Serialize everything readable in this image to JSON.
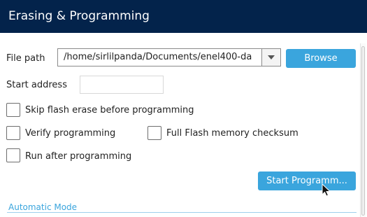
{
  "header": {
    "title": "Erasing & Programming"
  },
  "file_path": {
    "label": "File path",
    "value": "/home/sirlilpanda/Documents/enel400-da",
    "browse_label": "Browse"
  },
  "start_address": {
    "label": "Start address",
    "value": ""
  },
  "options": {
    "skip_flash_erase": {
      "label": "Skip flash erase before programming",
      "checked": false
    },
    "verify_programming": {
      "label": "Verify programming",
      "checked": false
    },
    "full_flash_checksum": {
      "label": "Full Flash memory checksum",
      "checked": false
    },
    "run_after_programming": {
      "label": "Run after programming",
      "checked": false
    }
  },
  "start_button": {
    "label": "Start Programm..."
  },
  "section": {
    "title": "Automatic Mode"
  },
  "colors": {
    "header_bg": "#03234b",
    "accent": "#3aa5dd"
  },
  "icons": {
    "dropdown": "chevron-down-icon",
    "cursor": "mouse-pointer-icon"
  }
}
